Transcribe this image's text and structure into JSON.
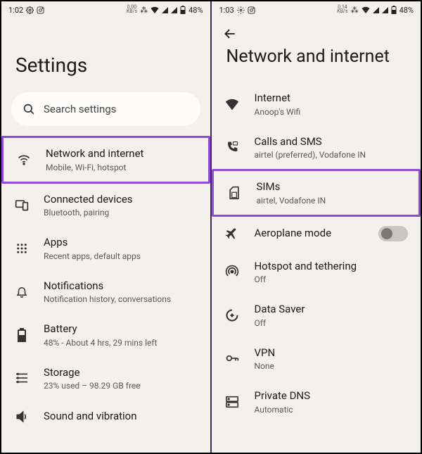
{
  "left": {
    "status": {
      "time": "1:02",
      "net_speed_top": "0.00",
      "net_speed_unit": "KB/s",
      "battery": "48%"
    },
    "title": "Settings",
    "search_placeholder": "Search settings",
    "items": [
      {
        "label": "Network and internet",
        "sub": "Mobile, Wi-Fi, hotspot",
        "icon": "wifi",
        "highlight": true
      },
      {
        "label": "Connected devices",
        "sub": "Bluetooth, pairing",
        "icon": "devices"
      },
      {
        "label": "Apps",
        "sub": "Recent apps, default apps",
        "icon": "apps"
      },
      {
        "label": "Notifications",
        "sub": "Notification history, conversations",
        "icon": "bell"
      },
      {
        "label": "Battery",
        "sub": "48% - About 4 hrs, 29 mins left",
        "icon": "battery"
      },
      {
        "label": "Storage",
        "sub": "23% used – 98.29 GB free",
        "icon": "storage"
      },
      {
        "label": "Sound and vibration",
        "sub": "",
        "icon": "sound"
      }
    ]
  },
  "right": {
    "status": {
      "time": "1:03",
      "net_speed_top": "0.14",
      "net_speed_unit": "KB/s",
      "battery": "48%"
    },
    "title": "Network and internet",
    "items": [
      {
        "label": "Internet",
        "sub": "Anoop's Wifi",
        "icon": "wifi-solid"
      },
      {
        "label": "Calls and SMS",
        "sub": "airtel (preferred), Vodafone IN",
        "icon": "phone"
      },
      {
        "label": "SIMs",
        "sub": "airtel, Vodafone IN",
        "icon": "sim",
        "highlight": true
      },
      {
        "label": "Aeroplane mode",
        "sub": "",
        "icon": "plane",
        "toggle": true
      },
      {
        "label": "Hotspot and tethering",
        "sub": "Off",
        "icon": "hotspot"
      },
      {
        "label": "Data Saver",
        "sub": "Off",
        "icon": "datasaver"
      },
      {
        "label": "VPN",
        "sub": "None",
        "icon": "vpn"
      },
      {
        "label": "Private DNS",
        "sub": "Automatic",
        "icon": "dns"
      }
    ]
  }
}
